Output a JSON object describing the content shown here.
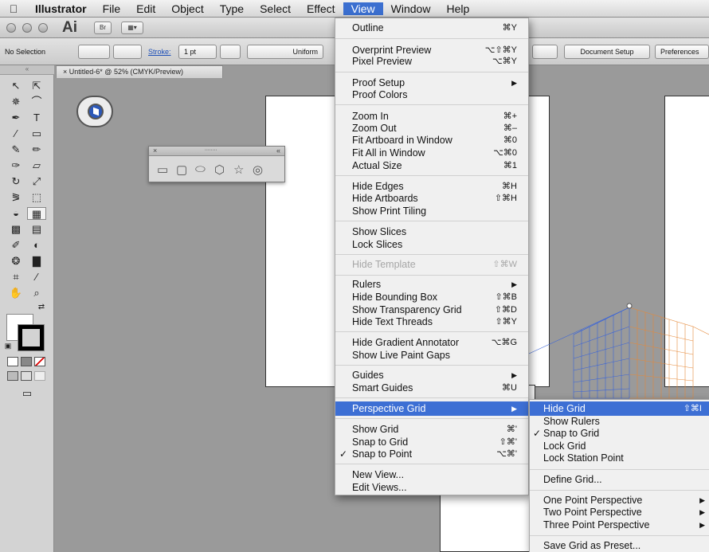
{
  "menubar": {
    "apple_glyph": "",
    "items": [
      "Illustrator",
      "File",
      "Edit",
      "Object",
      "Type",
      "Select",
      "Effect",
      "View",
      "Window",
      "Help"
    ]
  },
  "appbar": {
    "logo": "Ai",
    "bridge_label": "Br",
    "arrange_label": "▦▾"
  },
  "controlbar": {
    "selection": "No Selection",
    "stroke_label": "Stroke:",
    "stroke_weight": "1 pt",
    "profile": "Uniform",
    "document_setup": "Document Setup",
    "preferences": "Preferences"
  },
  "document": {
    "tab_title": "Untitled-6* @ 52% (CMYK/Preview)",
    "close_glyph": "×"
  },
  "shapes_panel": {
    "close": "×",
    "collapse": "«",
    "grip": "∙∙∙∙∙∙∙∙"
  },
  "toolbox": {
    "grip": "«"
  },
  "view_menu": {
    "outline": "Outline",
    "outline_sc": "⌘Y",
    "overprint_preview": "Overprint Preview",
    "overprint_preview_sc": "⌥⇧⌘Y",
    "pixel_preview": "Pixel Preview",
    "pixel_preview_sc": "⌥⌘Y",
    "proof_setup": "Proof Setup",
    "proof_colors": "Proof Colors",
    "zoom_in": "Zoom In",
    "zoom_in_sc": "⌘+",
    "zoom_out": "Zoom Out",
    "zoom_out_sc": "⌘–",
    "fit_artboard": "Fit Artboard in Window",
    "fit_artboard_sc": "⌘0",
    "fit_all": "Fit All in Window",
    "fit_all_sc": "⌥⌘0",
    "actual_size": "Actual Size",
    "actual_size_sc": "⌘1",
    "hide_edges": "Hide Edges",
    "hide_edges_sc": "⌘H",
    "hide_artboards": "Hide Artboards",
    "hide_artboards_sc": "⇧⌘H",
    "show_print_tiling": "Show Print Tiling",
    "show_slices": "Show Slices",
    "lock_slices": "Lock Slices",
    "hide_template": "Hide Template",
    "hide_template_sc": "⇧⌘W",
    "rulers": "Rulers",
    "hide_bounding_box": "Hide Bounding Box",
    "hide_bounding_box_sc": "⇧⌘B",
    "show_transparency_grid": "Show Transparency Grid",
    "show_transparency_grid_sc": "⇧⌘D",
    "hide_text_threads": "Hide Text Threads",
    "hide_text_threads_sc": "⇧⌘Y",
    "hide_gradient_annotator": "Hide Gradient Annotator",
    "hide_gradient_annotator_sc": "⌥⌘G",
    "show_live_paint_gaps": "Show Live Paint Gaps",
    "guides": "Guides",
    "smart_guides": "Smart Guides",
    "smart_guides_sc": "⌘U",
    "perspective_grid": "Perspective Grid",
    "show_grid": "Show Grid",
    "show_grid_sc": "⌘'",
    "snap_to_grid": "Snap to Grid",
    "snap_to_grid_sc": "⇧⌘'",
    "snap_to_point": "Snap to Point",
    "snap_to_point_sc": "⌥⌘'",
    "new_view": "New View...",
    "edit_views": "Edit Views...",
    "check": "✓",
    "arrow": "▶"
  },
  "perspective_submenu": {
    "hide_grid": "Hide Grid",
    "hide_grid_sc": "⇧⌘I",
    "show_rulers": "Show Rulers",
    "snap_to_grid": "Snap to Grid",
    "lock_grid": "Lock Grid",
    "lock_station_point": "Lock Station Point",
    "define_grid": "Define Grid...",
    "one_point": "One Point Perspective",
    "two_point": "Two Point Perspective",
    "three_point": "Three Point Perspective",
    "save_preset": "Save Grid as Preset...",
    "check": "✓",
    "arrow": "▶"
  }
}
